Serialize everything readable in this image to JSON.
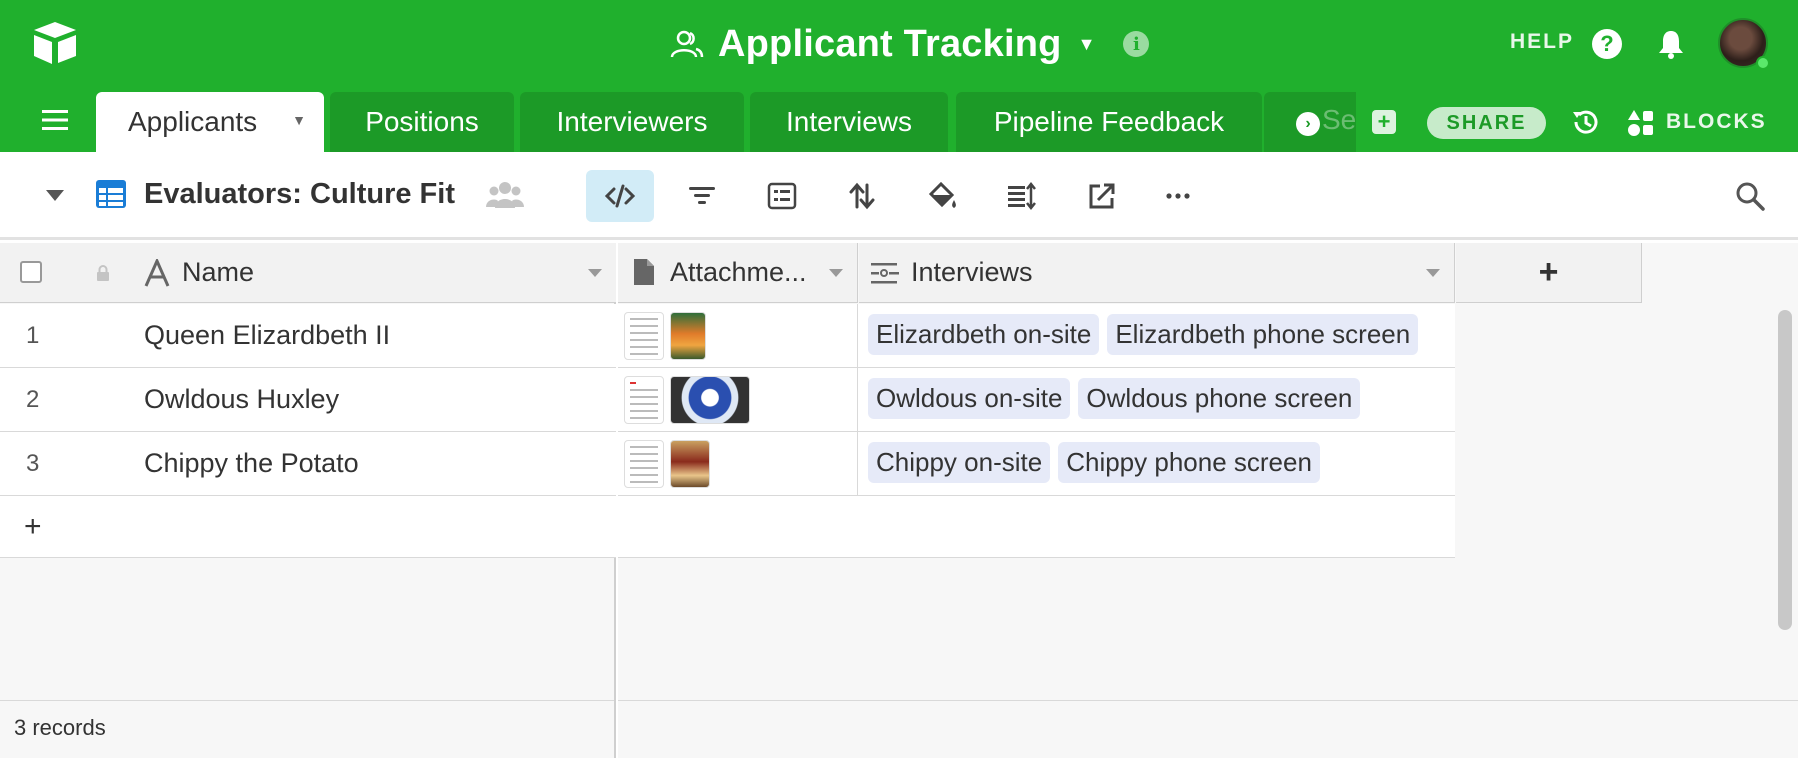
{
  "app": {
    "base_name": "Applicant Tracking",
    "help_label": "HELP",
    "help_icon_glyph": "?",
    "info_icon_glyph": "i",
    "share_label": "SHARE",
    "blocks_label": "BLOCKS",
    "add_tab_glyph": "+",
    "more_tabs_glyph": "›",
    "more_tabs_fade_text": "See",
    "brand_color": "#20b02d"
  },
  "tabs": [
    {
      "label": "Applicants",
      "active": true
    },
    {
      "label": "Positions"
    },
    {
      "label": "Interviewers"
    },
    {
      "label": "Interviews"
    },
    {
      "label": "Pipeline Feedback"
    }
  ],
  "view": {
    "name": "Evaluators: Culture Fit",
    "toolbar_icons": [
      "hide-fields-icon",
      "filter-icon",
      "group-icon",
      "sort-icon",
      "color-icon",
      "row-height-icon",
      "share-view-icon",
      "more-icon"
    ],
    "active_tool": "hide-fields-icon",
    "accent_color": "#1a7dd6"
  },
  "grid": {
    "columns": [
      {
        "label": "Name",
        "icon": "text-field-icon"
      },
      {
        "label": "Attachme...",
        "icon": "attachment-icon"
      },
      {
        "label": "Interviews",
        "icon": "linked-record-icon"
      }
    ],
    "add_column_glyph": "+",
    "rows": [
      {
        "num": "1",
        "name": "Queen Elizardbeth II",
        "interviews": [
          "Elizardbeth on-site",
          "Elizardbeth phone screen"
        ]
      },
      {
        "num": "2",
        "name": "Owldous Huxley",
        "interviews": [
          "Owldous on-site",
          "Owldous phone screen"
        ]
      },
      {
        "num": "3",
        "name": "Chippy the Potato",
        "interviews": [
          "Chippy on-site",
          "Chippy phone screen"
        ]
      }
    ],
    "add_row_glyph": "+",
    "record_count": "3 records"
  }
}
